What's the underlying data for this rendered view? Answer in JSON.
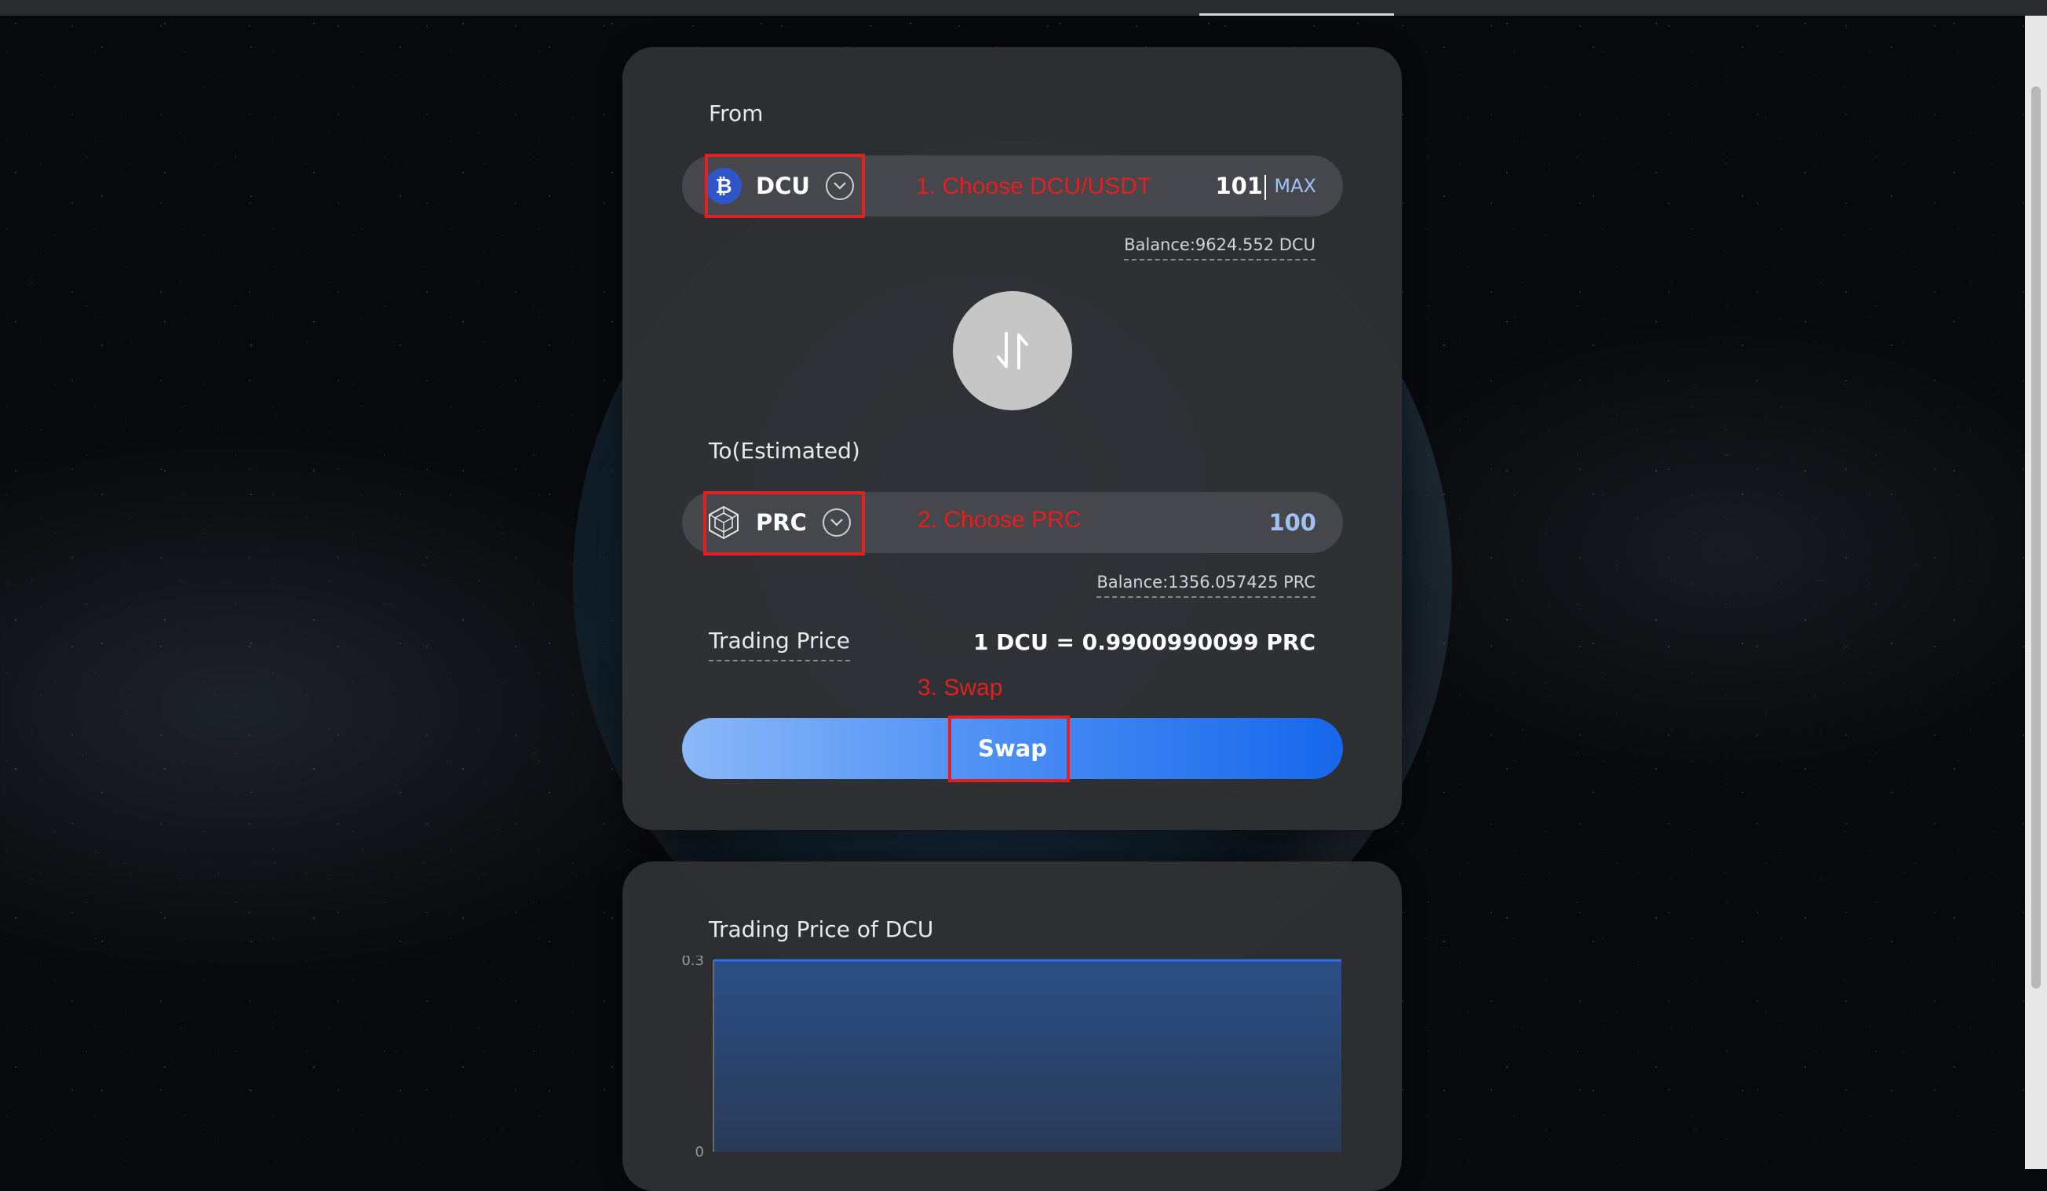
{
  "swap": {
    "from_label": "From",
    "to_label": "To(Estimated)",
    "from_token": {
      "symbol": "DCU",
      "icon": "bitcoin-like-coin-icon",
      "amount": "101",
      "max_label": "MAX",
      "balance": "Balance:9624.552 DCU"
    },
    "to_token": {
      "symbol": "PRC",
      "icon": "cube-icon",
      "amount": "100",
      "balance": "Balance:1356.057425 PRC"
    },
    "switch_icon": "swap-arrows-icon",
    "trading_price_label": "Trading Price",
    "trading_price_value": "1 DCU = 0.9900990099 PRC",
    "swap_button_label": "Swap"
  },
  "annotations": {
    "step1": "1. Choose DCU/USDT",
    "step2": "2. Choose PRC",
    "step3": "3. Swap"
  },
  "chart": {
    "title": "Trading Price of DCU"
  },
  "chart_data": {
    "type": "area",
    "title": "Trading Price of DCU",
    "xlabel": "",
    "ylabel": "",
    "ylim": [
      0,
      0.3
    ],
    "yticks": [
      "0.3",
      "0"
    ],
    "series": [
      {
        "values": [
          0.3,
          0.3
        ]
      }
    ],
    "grid": false,
    "colors": {
      "line": "#2f6fe8",
      "fill_top": "#2a4f86",
      "fill_bottom": "#2a3a58"
    }
  },
  "colors": {
    "accent": "#1667ec",
    "annotation": "#e32020",
    "dcu_coin": "#2f56c9"
  }
}
